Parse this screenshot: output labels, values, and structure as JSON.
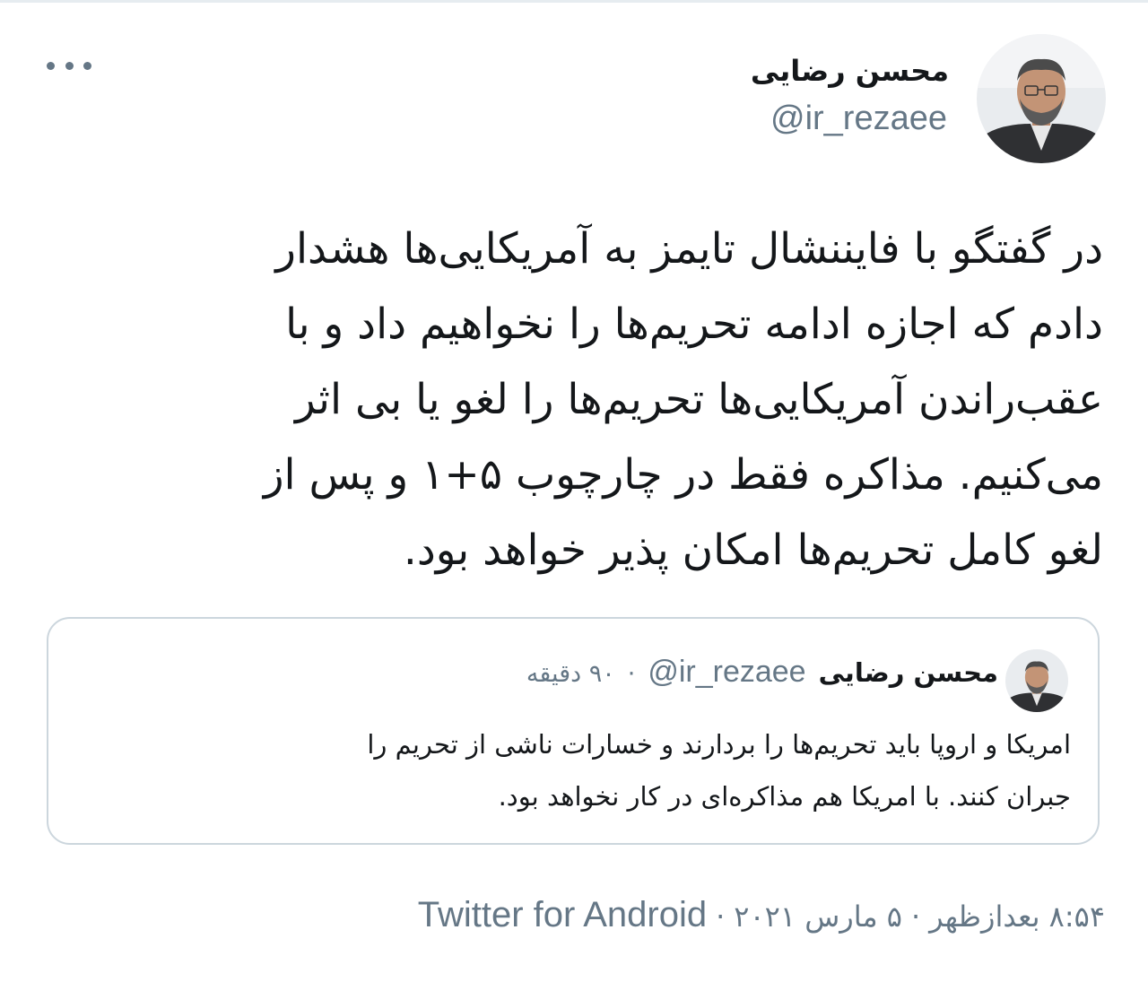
{
  "author": {
    "display_name": "محسن رضایی",
    "handle": "@ir_rezaee",
    "avatar_icon": "profile-photo-icon"
  },
  "tweet": {
    "lines": [
      "در گفتگو با فایننشال تایمز به آمریکایی‌ها هشدار",
      "دادم که اجازه ادامه تحریم‌ها را نخواهیم داد و با",
      "عقب‌راندن آمریکایی‌ها تحریم‌ها را لغو یا بی اثر",
      "می‌کنیم. مذاکره فقط در چارچوب ۵+۱ و پس از",
      "لغو کامل تحریم‌ها امکان پذیر خواهد بود."
    ]
  },
  "quoted_tweet": {
    "display_name": "محسن رضایی",
    "handle": "@ir_rezaee",
    "separator": "·",
    "time_ago": "۹۰ دقیقه",
    "lines": [
      "امریکا و اروپا باید تحریم‌ها را بردارند و خسارات ناشی از تحریم را",
      "جبران کنند. با امریکا هم مذاکره‌ای در کار نخواهد بود."
    ]
  },
  "meta": {
    "time": "۸:۵۴ بعدازظهر",
    "separator": "·",
    "date": "۵ مارس ۲۰۲۱",
    "source": "Twitter for Android"
  },
  "more_icon": "more-options-icon",
  "colors": {
    "text": "#14171a",
    "secondary": "#657786",
    "border": "#ccd6dd"
  }
}
